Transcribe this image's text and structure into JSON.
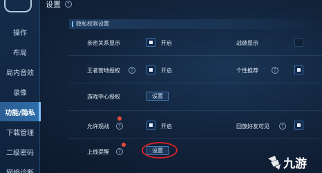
{
  "header": {
    "title": "设置"
  },
  "sidebar": {
    "items": [
      {
        "label": "操作"
      },
      {
        "label": "布局"
      },
      {
        "label": "局内音效"
      },
      {
        "label": "录像"
      },
      {
        "label": "功能/隐私"
      },
      {
        "label": "下载管理"
      },
      {
        "label": "二级密码"
      },
      {
        "label": "网络诊断"
      }
    ]
  },
  "section": {
    "title": "隐私权限设置"
  },
  "rows": {
    "intimacy": {
      "label": "亲密关系显示",
      "check_text": "开启"
    },
    "record": {
      "label": "战绩显示"
    },
    "camp": {
      "label": "王者营地授权",
      "check_text": "开启"
    },
    "recommend": {
      "label": "个性推荐"
    },
    "game_center": {
      "label": "游戏中心授权",
      "button": "设置"
    },
    "allow_watch": {
      "label": "允许观战",
      "check_text": "开启"
    },
    "replay_friends": {
      "label": "回放好友可见"
    },
    "online_alert": {
      "label": "上线提醒",
      "button": "设置"
    }
  },
  "watermark": {
    "text": "九游"
  },
  "colors": {
    "accent": "#2f6ea9",
    "highlight": "#d2222a",
    "badge": "#e84a3c"
  }
}
